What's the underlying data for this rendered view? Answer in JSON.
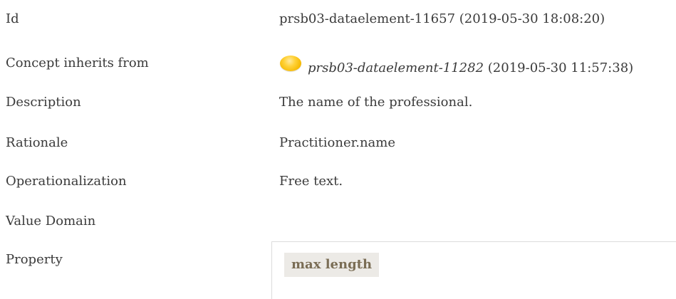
{
  "rows": {
    "id": {
      "label": "Id",
      "value": "prsb03-dataelement-11657 (2019-05-30 18:08:20)"
    },
    "inherits": {
      "label": "Concept inherits from",
      "link": "prsb03-dataelement-11282",
      "timestamp": "(2019-05-30 11:57:38)"
    },
    "description": {
      "label": "Description",
      "value": "The name of the professional."
    },
    "rationale": {
      "label": "Rationale",
      "value": "Practitioner.name"
    },
    "operationalization": {
      "label": "Operationalization",
      "value": "Free text."
    },
    "value_domain": {
      "label": "Value Domain"
    },
    "property": {
      "label": "Property",
      "pill": "max length"
    }
  },
  "icons": {
    "status": "yellow-status-dot-icon"
  },
  "colors": {
    "text": "#3a3a3a",
    "status_dot": "#f5b800",
    "pill_bg": "#eceae6",
    "pill_text": "#7a6d55",
    "box_border": "#dcdcdc"
  }
}
